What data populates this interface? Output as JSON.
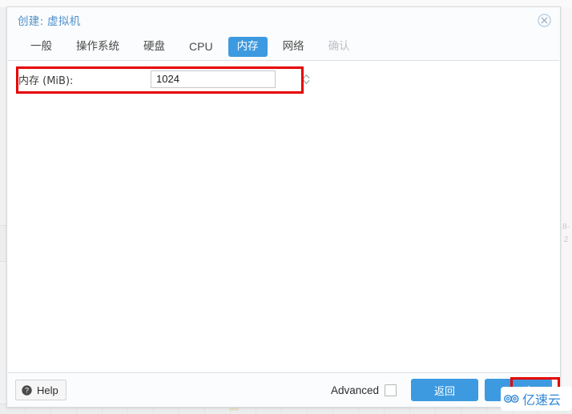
{
  "window": {
    "title": "创建: 虚拟机",
    "close_icon": "close-circle-icon"
  },
  "tabs": [
    {
      "label": "一般",
      "state": "normal",
      "name": "tab-general"
    },
    {
      "label": "操作系统",
      "state": "normal",
      "name": "tab-os"
    },
    {
      "label": "硬盘",
      "state": "normal",
      "name": "tab-hard-disk"
    },
    {
      "label": "CPU",
      "state": "normal",
      "name": "tab-cpu"
    },
    {
      "label": "内存",
      "state": "active",
      "name": "tab-memory"
    },
    {
      "label": "网络",
      "state": "normal",
      "name": "tab-network"
    },
    {
      "label": "确认",
      "state": "disabled",
      "name": "tab-confirm"
    }
  ],
  "form": {
    "memory_label": "内存 (MiB):",
    "memory_value": "1024",
    "memory_placeholder": "1024",
    "spinner_icon": "spinner-up-down-icon"
  },
  "footer": {
    "help_label": "Help",
    "help_icon": "question-mark-icon",
    "advanced_label": "Advanced",
    "advanced_checked": false,
    "back_label": "返回",
    "next_label": "下一步"
  },
  "annotations": {
    "memory_row_highlight_color": "#e60000",
    "next_button_highlight_color": "#e60000"
  },
  "watermark": {
    "text": "亿速云",
    "logo_icon": "cloud-spiral-icon",
    "color": "#2f86d6"
  },
  "background": {
    "right_edge_text_1": "8-",
    "right_edge_text_2": "2",
    "ghost_top_text": "＿ ＿＿ ＿＿＿"
  },
  "theme": {
    "accent": "#3d9ae0",
    "title_color": "#4e8fc9",
    "dialog_bg": "#ffffff",
    "chrome_bg": "#fbfcfd"
  }
}
